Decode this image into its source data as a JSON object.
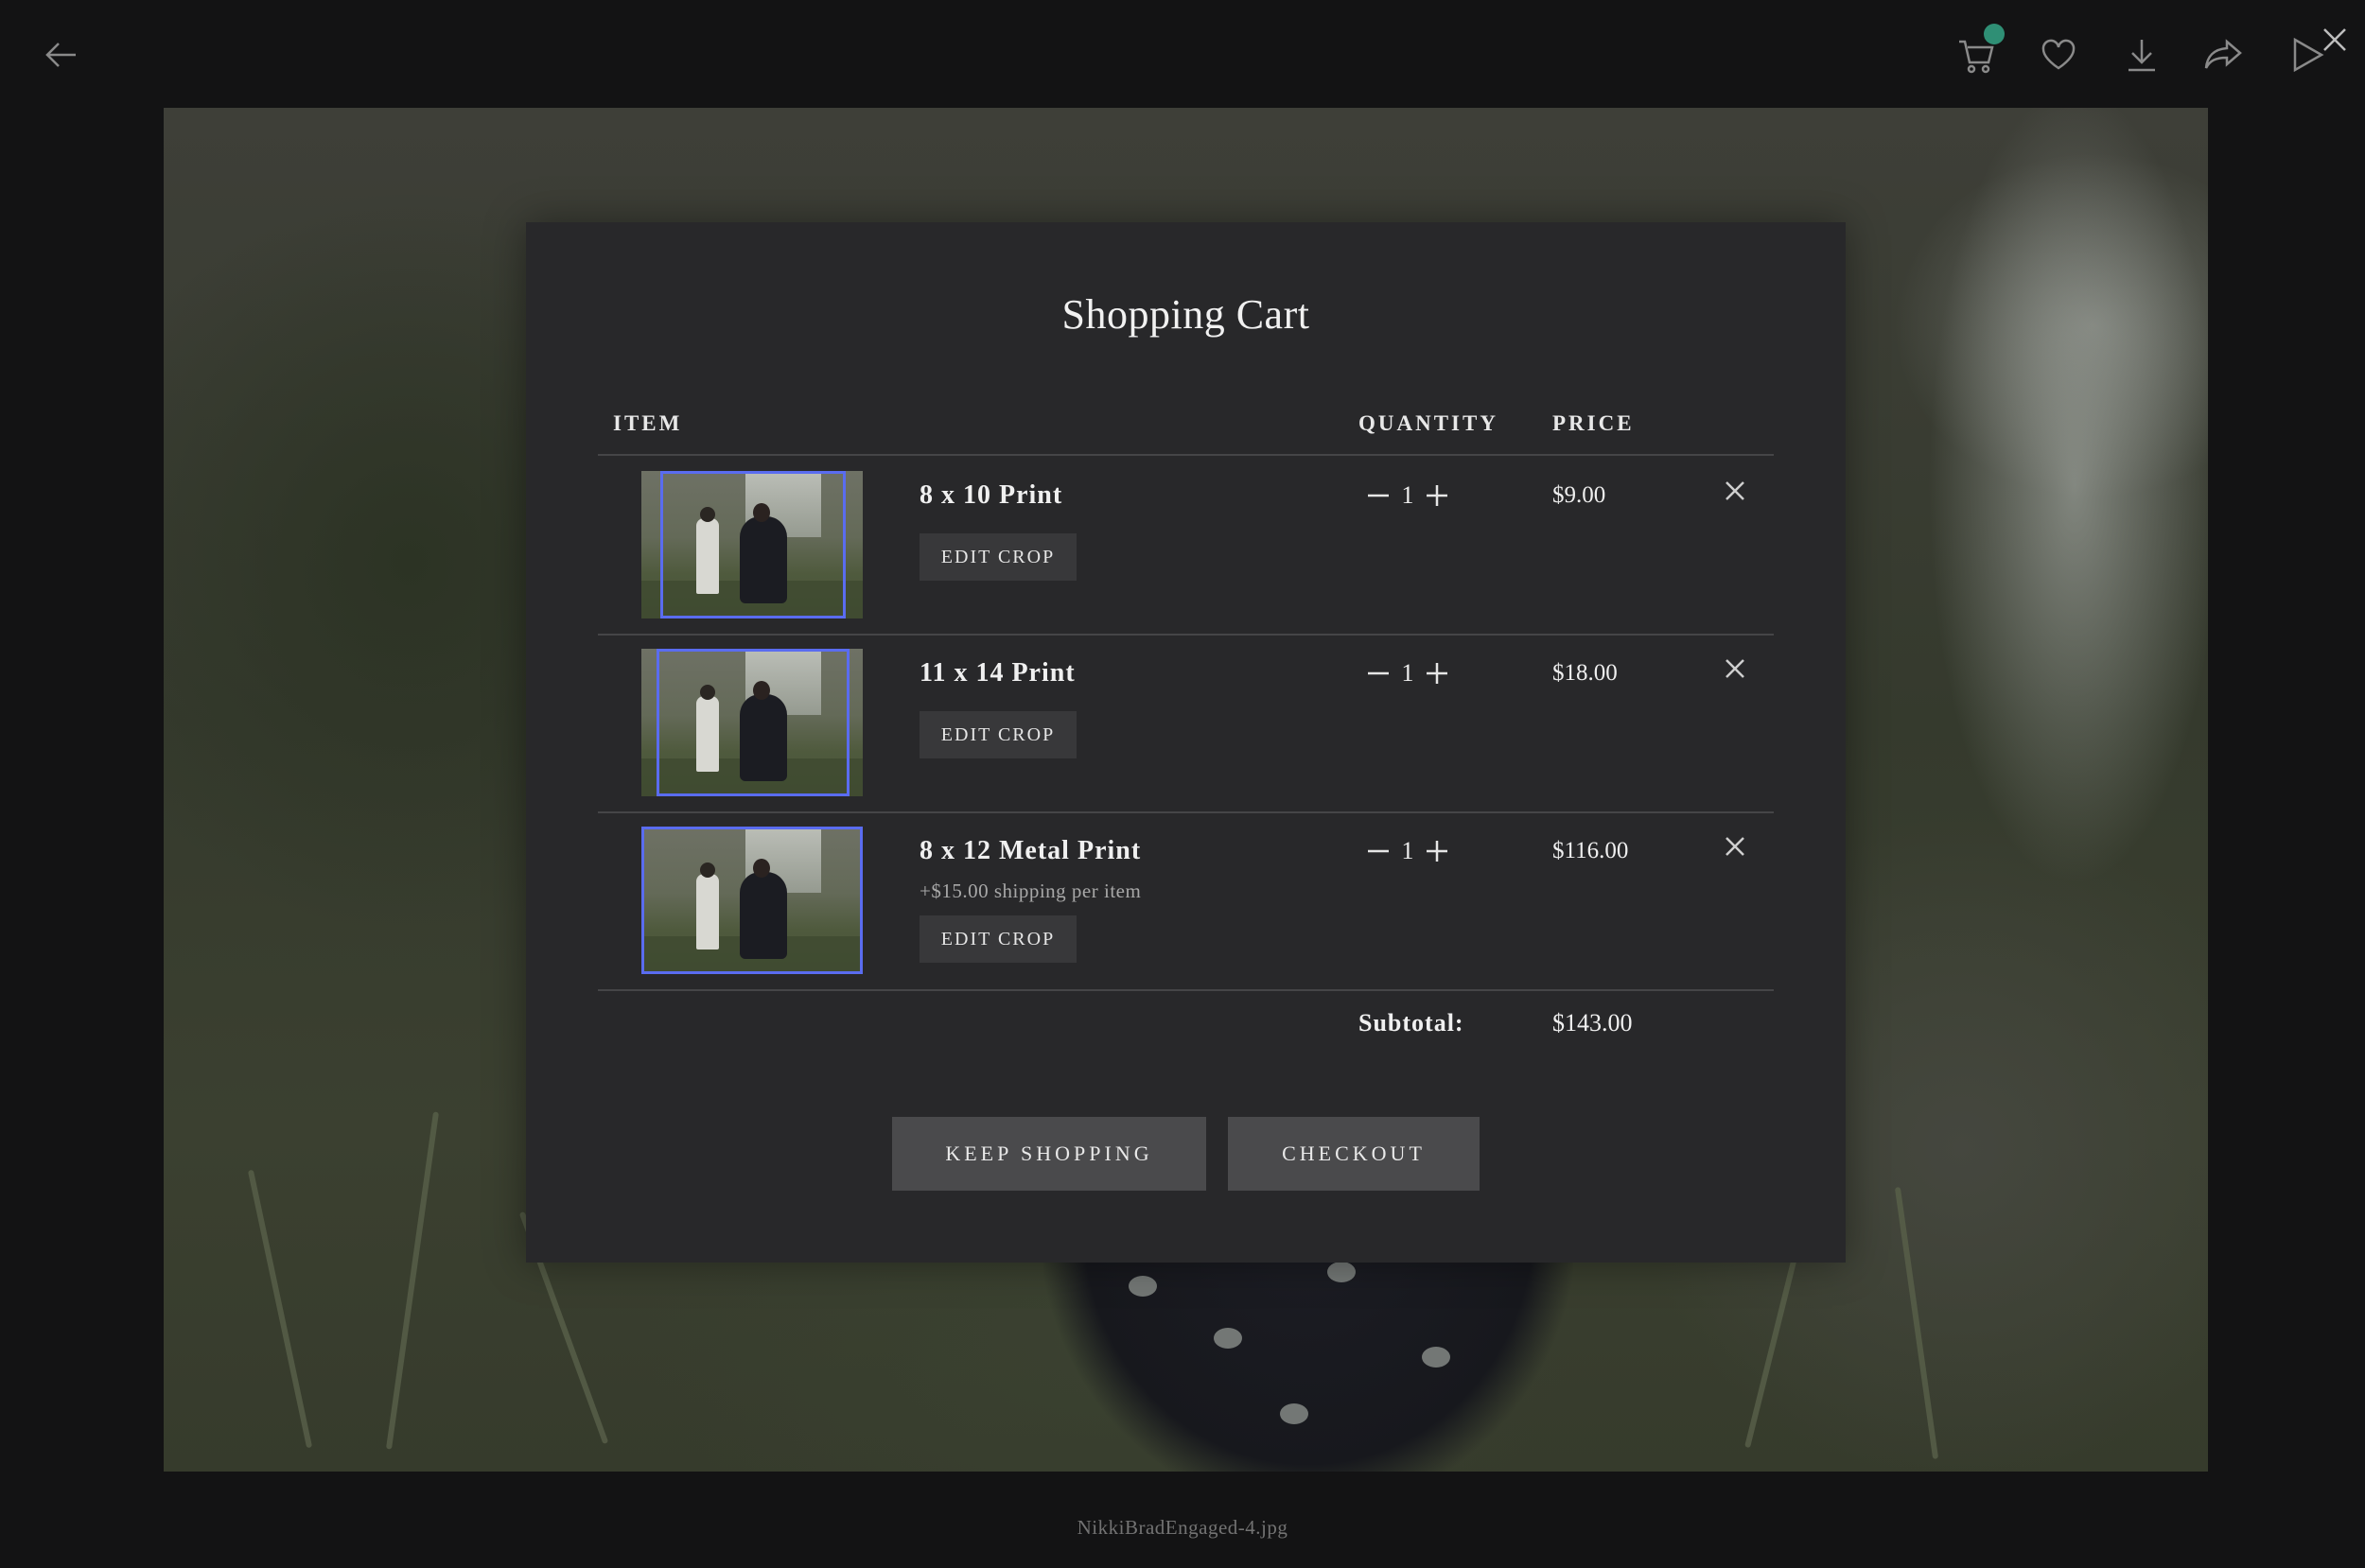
{
  "viewer": {
    "filename": "NikkiBradEngaged-4.jpg",
    "toolbar": [
      "back-arrow-icon",
      "cart-icon",
      "heart-icon",
      "download-icon",
      "share-icon",
      "play-icon",
      "close-icon"
    ]
  },
  "cart": {
    "title": "Shopping Cart",
    "columns": {
      "item": "ITEM",
      "quantity": "QUANTITY",
      "price": "PRICE"
    },
    "items": [
      {
        "name": "8 x 10 Print",
        "note": "",
        "quantity": "1",
        "price": "$9.00",
        "edit_label": "EDIT CROP"
      },
      {
        "name": "11 x 14 Print",
        "note": "",
        "quantity": "1",
        "price": "$18.00",
        "edit_label": "EDIT CROP"
      },
      {
        "name": "8 x 12 Metal Print",
        "note": "+$15.00 shipping per item",
        "quantity": "1",
        "price": "$116.00",
        "edit_label": "EDIT CROP"
      }
    ],
    "subtotal_label": "Subtotal:",
    "subtotal_value": "$143.00",
    "keep_shopping_label": "KEEP SHOPPING",
    "checkout_label": "CHECKOUT"
  },
  "colors": {
    "modal_bg": "#28282a",
    "crop_frame": "#5a6cf0",
    "cart_badge": "#2f8f75"
  }
}
